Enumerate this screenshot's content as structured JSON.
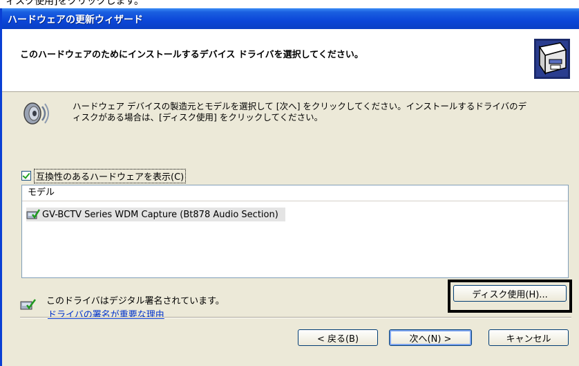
{
  "caption": "ィスク使用]をクリックします。",
  "window": {
    "title": "ハードウェアの更新ウィザード"
  },
  "header": {
    "title": "このハードウェアのためにインストールするデバイス ドライバを選択してください。"
  },
  "description": {
    "line1": "ハードウェア デバイスの製造元とモデルを選択して [次へ] をクリックしてください。インストールするドライバのデ",
    "line2": "ィスクがある場合は、[ディスク使用] をクリックしてください。"
  },
  "compat_checkbox": {
    "label": "互換性のあるハードウェアを表示(C)",
    "checked": true
  },
  "model_list": {
    "header": "モデル",
    "items": [
      "GV-BCTV Series WDM Capture (Bt878 Audio Section)"
    ]
  },
  "signature": {
    "text": "このドライバはデジタル署名されています。",
    "link": "ドライバの署名が重要な理由"
  },
  "buttons": {
    "disk": "ディスク使用(H)...",
    "back": "< 戻る(B)",
    "next": "次へ(N) >",
    "cancel": "キャンセル"
  },
  "icons": {
    "header": "hardware-box-icon",
    "speaker": "speaker-icon",
    "signed": "signed-driver-icon",
    "item": "driver-item-icon"
  },
  "colors": {
    "titlebar": "#0b46d8",
    "dialog_bg": "#ece9d8",
    "link": "#0033cc",
    "highlight_frame": "#000000"
  }
}
